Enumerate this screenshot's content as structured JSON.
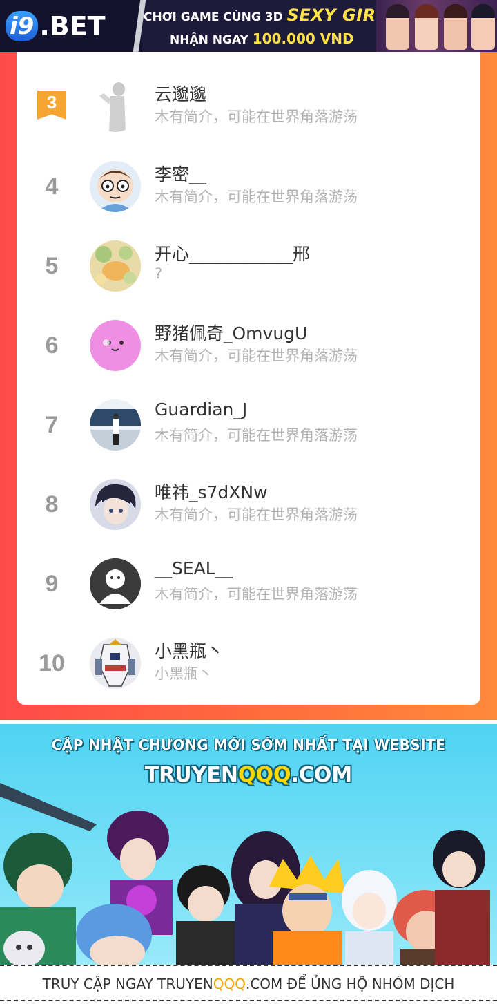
{
  "ad": {
    "logo_i9": "i9",
    "logo_bet": ".BET",
    "line1_prefix": "CHƠI GAME CÙNG 3D",
    "line1_highlight": "SEXY GIRL",
    "line2_prefix": "NHẬN NGAY",
    "line2_amount": "100.000 VND"
  },
  "ranking": {
    "rows": [
      {
        "rank": "3",
        "badge": true,
        "name": "云邈邈",
        "bio": "木有简介，可能在世界角落游荡"
      },
      {
        "rank": "4",
        "badge": false,
        "name": "李密__",
        "bio": "木有简介，可能在世界角落游荡"
      },
      {
        "rank": "5",
        "badge": false,
        "name": "开心____________邢",
        "bio": "?"
      },
      {
        "rank": "6",
        "badge": false,
        "name": "野猪佩奇_OmvugU",
        "bio": "木有简介，可能在世界角落游荡"
      },
      {
        "rank": "7",
        "badge": false,
        "name": "Guardian_J",
        "bio": "木有简介，可能在世界角落游荡"
      },
      {
        "rank": "8",
        "badge": false,
        "name": "唯祎_s7dXNw",
        "bio": "木有简介，可能在世界角落游荡"
      },
      {
        "rank": "9",
        "badge": false,
        "name": "__SEAL__",
        "bio": "木有简介，可能在世界角落游荡"
      },
      {
        "rank": "10",
        "badge": false,
        "name": "小黑瓶丶",
        "bio": "小黑瓶丶"
      }
    ]
  },
  "promo": {
    "headline": "CẬP NHẬT CHƯƠNG MỚI SỚM NHẤT TẠI WEBSITE",
    "site_prefix": "TRUYEN",
    "site_qqq": "QQQ",
    "site_suffix": ".COM",
    "footer_prefix": "TRUY CẬP NGAY TRUYEN",
    "footer_qqq": "QQQ",
    "footer_suffix": ".COM ĐỂ ỦNG HỘ NHÓM DỊCH"
  }
}
